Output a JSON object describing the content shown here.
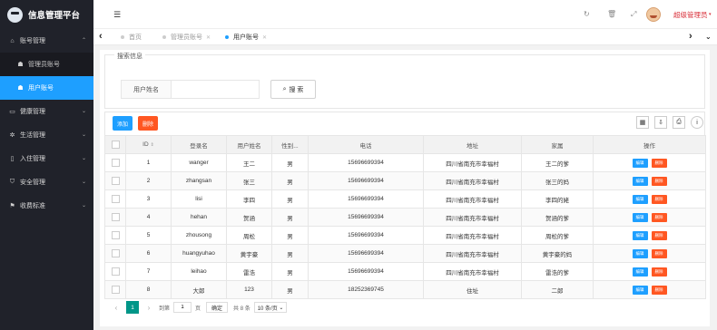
{
  "app": {
    "title": "信息管理平台"
  },
  "sidebar": {
    "groups": [
      {
        "label": "账号管理",
        "icon": "home-icon",
        "expanded": true,
        "children": [
          {
            "label": "管理员账号",
            "icon": "users-icon",
            "active": false
          },
          {
            "label": "用户账号",
            "icon": "user-icon",
            "active": true
          }
        ]
      },
      {
        "label": "健康管理",
        "icon": "monitor-icon"
      },
      {
        "label": "生活管理",
        "icon": "gears-icon"
      },
      {
        "label": "入住管理",
        "icon": "door-icon"
      },
      {
        "label": "安全管理",
        "icon": "shield-icon"
      },
      {
        "label": "收费标准",
        "icon": "flag-icon"
      }
    ]
  },
  "header": {
    "user_name": "超级管理员"
  },
  "tabs": [
    {
      "label": "首页",
      "closable": false,
      "active": false
    },
    {
      "label": "管理员账号",
      "closable": true,
      "active": false
    },
    {
      "label": "用户账号",
      "closable": true,
      "active": true
    }
  ],
  "search": {
    "legend": "搜索信息",
    "field_label": "用户姓名",
    "input_value": "",
    "button_label": "搜 索"
  },
  "toolbar": {
    "add_label": "添加",
    "delete_label": "删除"
  },
  "table": {
    "headers": [
      "",
      "ID",
      "登录名",
      "用户姓名",
      "性别...",
      "电话",
      "地址",
      "家属",
      "操作"
    ],
    "edit_label": "编辑",
    "delete_label": "删除",
    "rows": [
      {
        "id": "1",
        "login": "wanger",
        "name": "王二",
        "gender": "男",
        "phone": "15696699394",
        "address": "四川省南充市幸福村",
        "family": "王二的爹"
      },
      {
        "id": "2",
        "login": "zhangsan",
        "name": "张三",
        "gender": "男",
        "phone": "15696699394",
        "address": "四川省南充市幸福村",
        "family": "张三的妈"
      },
      {
        "id": "3",
        "login": "lisi",
        "name": "李四",
        "gender": "男",
        "phone": "15696699394",
        "address": "四川省南充市幸福村",
        "family": "李四的姥"
      },
      {
        "id": "4",
        "login": "hehan",
        "name": "贺涵",
        "gender": "男",
        "phone": "15696699394",
        "address": "四川省南充市幸福村",
        "family": "贺涵的爹"
      },
      {
        "id": "5",
        "login": "zhousong",
        "name": "周松",
        "gender": "男",
        "phone": "15696699394",
        "address": "四川省南充市幸福村",
        "family": "周松的爹"
      },
      {
        "id": "6",
        "login": "huangyuhao",
        "name": "黄宇豪",
        "gender": "男",
        "phone": "15696699394",
        "address": "四川省南充市幸福村",
        "family": "黄宇豪的妈"
      },
      {
        "id": "7",
        "login": "leihao",
        "name": "雷浩",
        "gender": "男",
        "phone": "15696699394",
        "address": "四川省南充市幸福村",
        "family": "雷浩的爹"
      },
      {
        "id": "8",
        "login": "大郎",
        "name": "123",
        "gender": "男",
        "phone": "18252369745",
        "address": "住址",
        "family": "二郎"
      }
    ]
  },
  "pager": {
    "current_page": "1",
    "goto_label": "到第",
    "page_input": "1",
    "page_label": "页",
    "ok_label": "确定",
    "total_label": "共 8 条",
    "page_size": "10 条/页"
  },
  "colors": {
    "sidebar_bg": "#20222a",
    "active_blue": "#1e9fff",
    "danger_orange": "#ff5722",
    "pager_green": "#009688"
  }
}
